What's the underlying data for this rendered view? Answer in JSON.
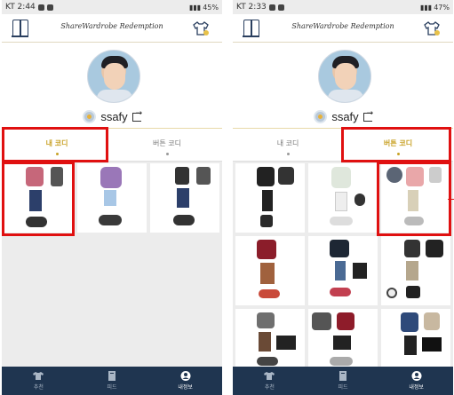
{
  "screens": [
    {
      "status": {
        "left": "KT 2:44",
        "right": "45%"
      },
      "app_title": "ShareWardrobe Redemption",
      "username": "ssafy",
      "tabs": [
        {
          "label": "내 코디",
          "active": true
        },
        {
          "label": "버튼 코디",
          "active": false
        }
      ],
      "nav": [
        {
          "label": "추천",
          "active": false
        },
        {
          "label": "피드",
          "active": false
        },
        {
          "label": "내정보",
          "active": true
        }
      ],
      "grid_count": 3
    },
    {
      "status": {
        "left": "KT 2:33",
        "right": "47%"
      },
      "app_title": "ShareWardrobe Redemption",
      "username": "ssafy",
      "tabs": [
        {
          "label": "내 코디",
          "active": false
        },
        {
          "label": "버튼 코디",
          "active": true
        }
      ],
      "nav": [
        {
          "label": "추천",
          "active": false
        },
        {
          "label": "피드",
          "active": false
        },
        {
          "label": "내정보",
          "active": true
        }
      ],
      "grid_count": 9
    }
  ],
  "colors": {
    "accent": "#c9a227",
    "nav_bg": "#1f3550",
    "highlight": "#e01010",
    "background": "#ececec"
  },
  "icons": {
    "closet": "closet-icon",
    "shirt": "shirt-hanger-icon",
    "logout": "logout-icon",
    "nav_recommend": "shirt-icon",
    "nav_feed": "book-icon",
    "nav_profile": "person-circle-icon"
  }
}
